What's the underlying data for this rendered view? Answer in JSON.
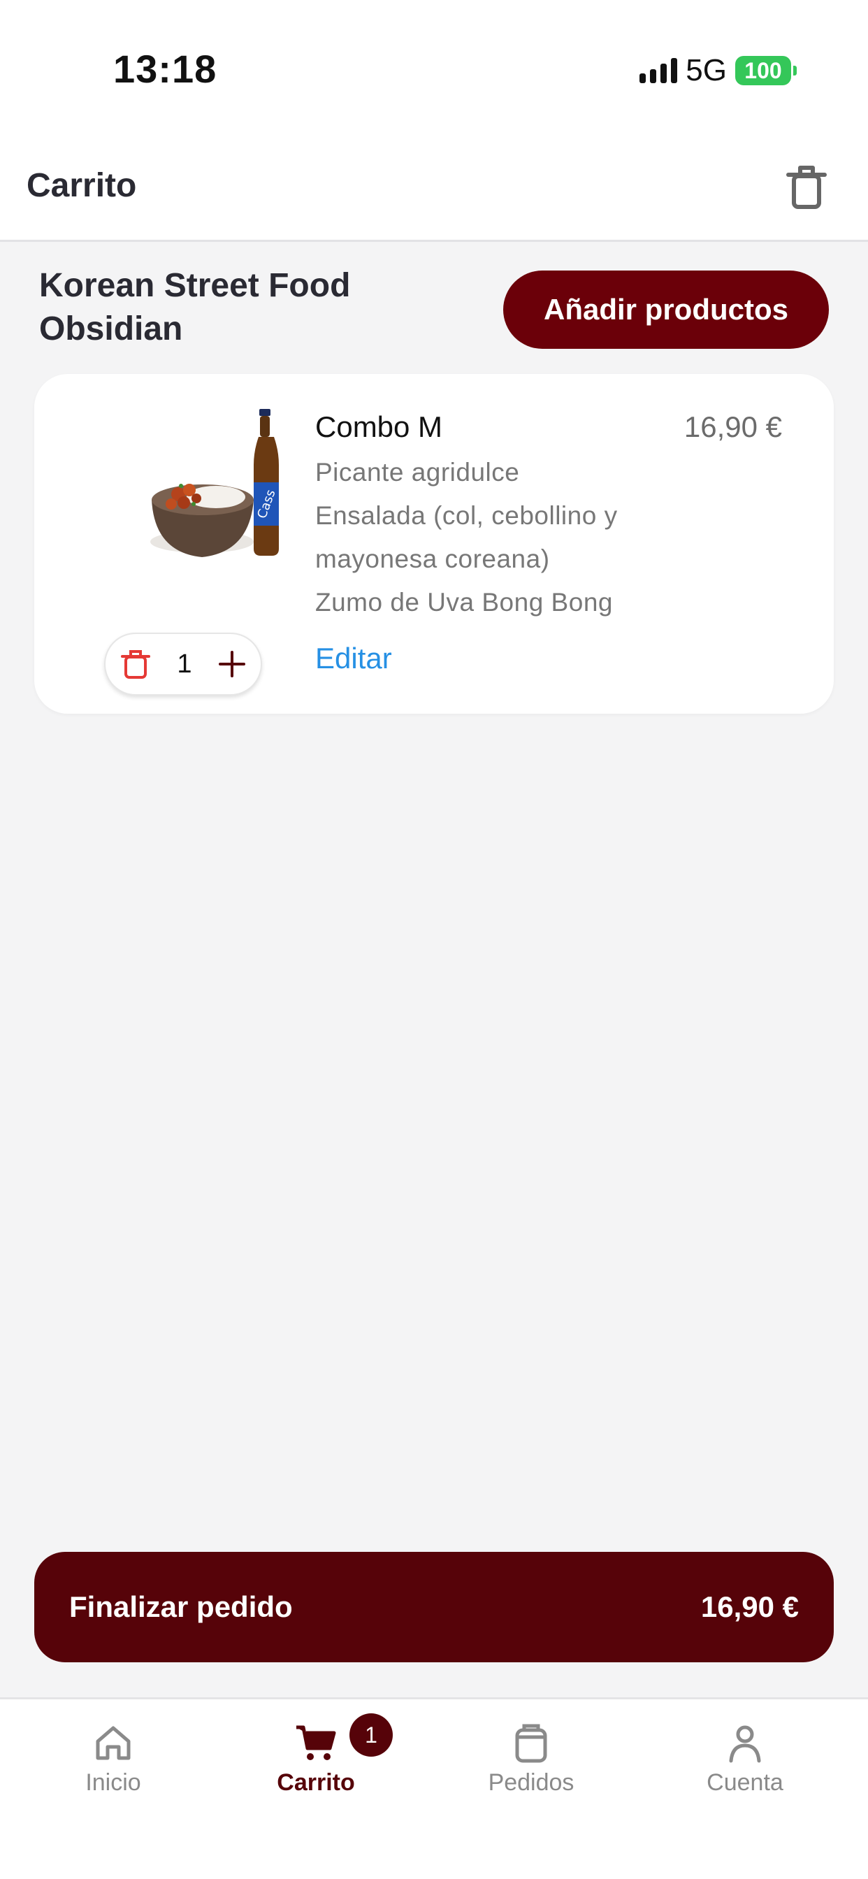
{
  "status_bar": {
    "time": "13:18",
    "network": "5G",
    "battery": "100"
  },
  "header": {
    "title": "Carrito",
    "trash_icon": "trash-icon"
  },
  "store": {
    "name": "Korean Street Food Obsidian",
    "add_button": "Añadir productos"
  },
  "cart_item": {
    "name": "Combo M",
    "price": "16,90 €",
    "options": [
      "Picante agridulce",
      "Ensalada (col, cebollino y",
      "mayonesa coreana)",
      "Zumo de Uva Bong Bong"
    ],
    "edit_label": "Editar",
    "quantity": "1"
  },
  "checkout": {
    "label": "Finalizar pedido",
    "total": "16,90 €"
  },
  "tabbar": {
    "items": [
      {
        "label": "Inicio",
        "icon": "home-icon"
      },
      {
        "label": "Carrito",
        "icon": "cart-icon",
        "badge": "1"
      },
      {
        "label": "Pedidos",
        "icon": "orders-icon"
      },
      {
        "label": "Cuenta",
        "icon": "account-icon"
      }
    ]
  },
  "colors": {
    "brand": "#560309",
    "button": "#6b0009",
    "link": "#2690e4",
    "battery": "#34c759",
    "trash_red": "#e53935"
  }
}
